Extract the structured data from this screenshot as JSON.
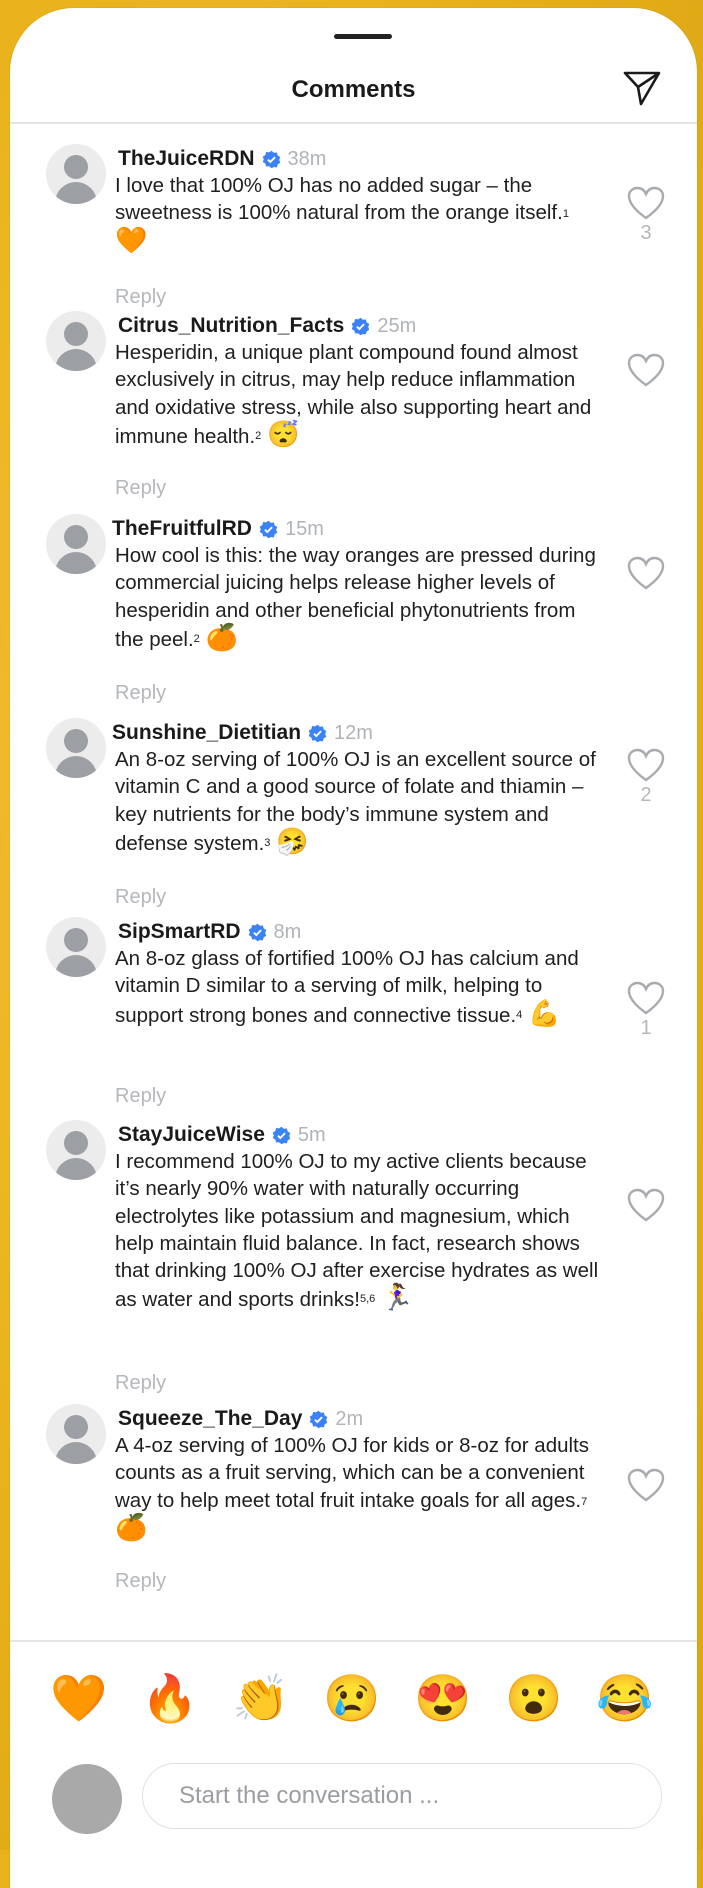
{
  "header": {
    "title": "Comments",
    "send_icon": "paper-plane-icon"
  },
  "comments": [
    {
      "username": "TheJuiceRDN",
      "verified": true,
      "time": "38m",
      "text": "I love that 100% OJ has no added sugar – the sweetness is 100% natural from the orange itself.",
      "sup": "1",
      "emoji": "🧡",
      "reply": "Reply",
      "likes": "3"
    },
    {
      "username": "Citrus_Nutrition_Facts",
      "verified": true,
      "time": "25m",
      "text": "Hesperidin, a unique plant compound found almost exclusively in citrus, may help reduce inflammation and oxidative stress, while also supporting heart and immune health.",
      "sup": "2",
      "emoji": "😴",
      "reply": "Reply",
      "likes": ""
    },
    {
      "username": "TheFruitfulRD",
      "verified": true,
      "time": "15m",
      "text": "How cool is this: the way oranges are pressed during commercial juicing helps release higher levels of hesperidin and other beneficial phytonutrients from the peel.",
      "sup": "2",
      "emoji": "🍊",
      "reply": "Reply",
      "likes": ""
    },
    {
      "username": "Sunshine_Dietitian",
      "verified": true,
      "time": "12m",
      "text": "An 8-oz serving of 100% OJ is an excellent source of vitamin C and a good source of folate and thiamin – key nutrients for the body’s immune system and defense system.",
      "sup": "3",
      "emoji": "🤧",
      "reply": "Reply",
      "likes": "2"
    },
    {
      "username": "SipSmartRD",
      "verified": true,
      "time": "8m",
      "text": "An 8-oz glass of fortified 100% OJ has calcium and vitamin D similar to a serving of milk, helping to support strong bones and connective tissue.",
      "sup": "4",
      "emoji": "💪",
      "reply": "Reply",
      "likes": "1"
    },
    {
      "username": "StayJuiceWise",
      "verified": true,
      "time": "5m",
      "text": "I recommend 100% OJ to my active clients because it’s nearly 90% water with naturally occurring electrolytes like potassium and magnesium, which help maintain fluid balance. In fact, research shows that drinking 100% OJ after exercise hydrates as well as water and sports drinks!",
      "sup": "5,6",
      "emoji": "🏃‍♀️",
      "reply": "Reply",
      "likes": ""
    },
    {
      "username": "Squeeze_The_Day",
      "verified": true,
      "time": "2m",
      "text": "A 4-oz serving of 100% OJ for kids or 8-oz for adults counts as a fruit serving, which can be a convenient way to help meet total fruit intake goals for all ages.",
      "sup": "7",
      "emoji": "🍊",
      "reply": "Reply",
      "likes": ""
    }
  ],
  "reactions": [
    {
      "emoji": "🧡",
      "name": "orange-heart"
    },
    {
      "emoji": "🔥",
      "name": "fire"
    },
    {
      "emoji": "👏",
      "name": "clapping-hands"
    },
    {
      "emoji": "😢",
      "name": "crying-face"
    },
    {
      "emoji": "😍",
      "name": "heart-eyes"
    },
    {
      "emoji": "😮",
      "name": "surprised-face"
    },
    {
      "emoji": "😂",
      "name": "tears-of-joy"
    }
  ],
  "composer": {
    "placeholder": "Start the conversation ..."
  },
  "colors": {
    "background": "#e9b21c",
    "verified_badge": "#3b82f6",
    "muted_text": "#b0b4b8",
    "divider": "#e4e4e4"
  }
}
